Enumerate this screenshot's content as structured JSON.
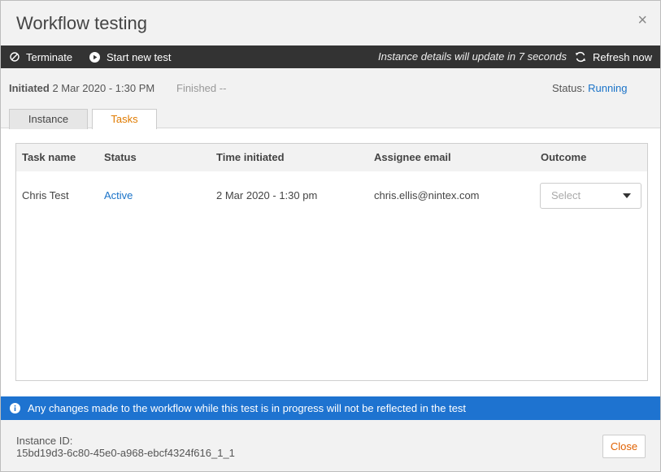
{
  "dialog": {
    "title": "Workflow testing",
    "close_icon": "×"
  },
  "toolbar": {
    "terminate_label": "Terminate",
    "start_new_label": "Start new test",
    "update_note": "Instance details will update in 7 seconds",
    "refresh_label": "Refresh now"
  },
  "meta": {
    "initiated_label": "Initiated",
    "initiated_value": "2 Mar 2020 - 1:30 PM",
    "finished_label": "Finished --",
    "status_label": "Status:",
    "status_value": "Running"
  },
  "tabs": [
    {
      "label": "Instance",
      "active": false
    },
    {
      "label": "Tasks",
      "active": true
    }
  ],
  "table": {
    "columns": [
      "Task name",
      "Status",
      "Time initiated",
      "Assignee email",
      "Outcome"
    ],
    "rows": [
      {
        "task_name": "Chris Test",
        "status": "Active",
        "time_initiated": "2 Mar 2020 - 1:30 pm",
        "assignee_email": "chris.ellis@nintex.com",
        "outcome_placeholder": "Select"
      }
    ]
  },
  "banner": {
    "icon": "info-icon",
    "text": "Any changes made to the workflow while this test is in progress will not be reflected in the test"
  },
  "footer": {
    "instance_label": "Instance ID:",
    "instance_id": "15bd19d3-6c80-45e0-a968-ebcf4324f616_1_1",
    "close_label": "Close"
  },
  "colors": {
    "toolbar_bg": "#333333",
    "banner_bg": "#1e73d0",
    "link_blue": "#1a73c8",
    "active_tab": "#e07b00"
  }
}
